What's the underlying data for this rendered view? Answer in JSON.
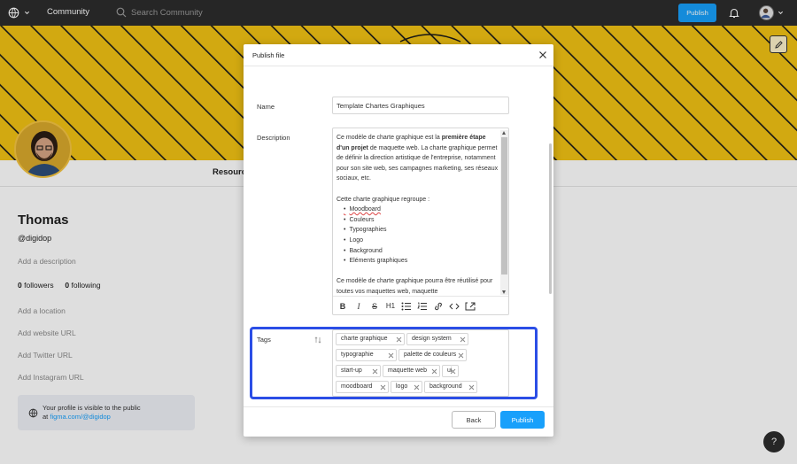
{
  "topbar": {
    "community_label": "Community",
    "search_placeholder": "Search Community",
    "publish_label": "Publish"
  },
  "profile": {
    "resources_tab": "Resources",
    "name": "Thomas",
    "handle": "@digidop",
    "add_description": "Add a description",
    "followers_count": "0",
    "followers_label": "followers",
    "following_count": "0",
    "following_label": "following",
    "add_location": "Add a location",
    "add_website": "Add website URL",
    "add_twitter": "Add Twitter URL",
    "add_instagram": "Add Instagram URL",
    "public_notice": "Your profile is visible to the public",
    "public_at": "at",
    "public_url": "figma.com/@digidop"
  },
  "modal": {
    "title": "Publish file",
    "name_label": "Name",
    "name_value": "Template Chartes Graphiques",
    "description_label": "Description",
    "description": {
      "p1_before": "Ce modèle de charte graphique est la ",
      "p1_bold": "première étape d'un projet",
      "p1_after": " de maquette web. La charte graphique permet de définir la direction artistique de l'entreprise, notamment pour son site web, ses campagnes marketing, ses réseaux sociaux, etc.",
      "list_intro": "Cette charte graphique regroupe :",
      "list_items": [
        "Moodboard",
        "Couleurs",
        "Typographies",
        "Logo",
        "Background",
        "Eléments graphiques"
      ],
      "p3": "Ce modèle de charte graphique pourra être réutilisé pour toutes vos maquettes web, maquette"
    },
    "toolbar": [
      "B",
      "I",
      "S",
      "H1",
      "bullets",
      "numbers",
      "link",
      "code",
      "embed"
    ],
    "tags_label": "Tags",
    "tags": [
      "charte graphique",
      "design system",
      "typographie",
      "palette de couleurs",
      "start-up",
      "maquette web",
      "ui",
      "moodboard",
      "logo",
      "background"
    ],
    "back_label": "Back",
    "publish_label": "Publish"
  },
  "help_label": "?",
  "colors": {
    "accent": "#18a0fb",
    "banner_yellow": "#f2c314",
    "highlight": "#2b4ee6",
    "topbar": "#2c2c2c"
  }
}
